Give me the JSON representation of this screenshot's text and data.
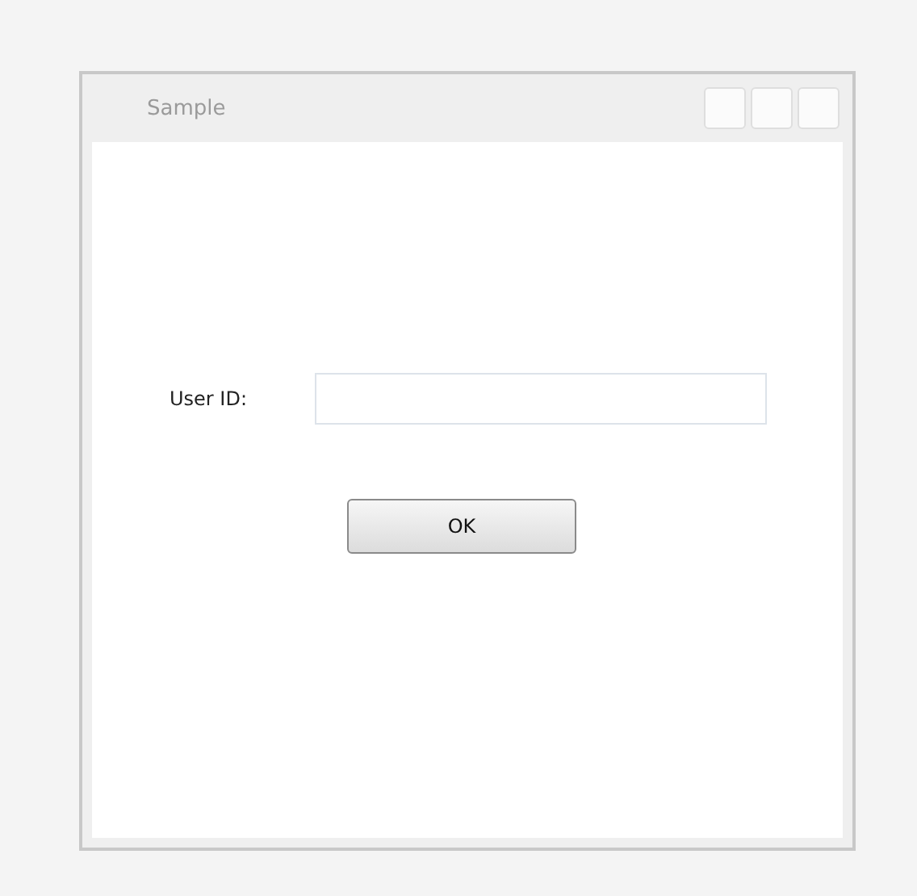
{
  "window": {
    "title": "Sample"
  },
  "form": {
    "label": "User ID:"
  },
  "buttons": [
    "OK"
  ]
}
